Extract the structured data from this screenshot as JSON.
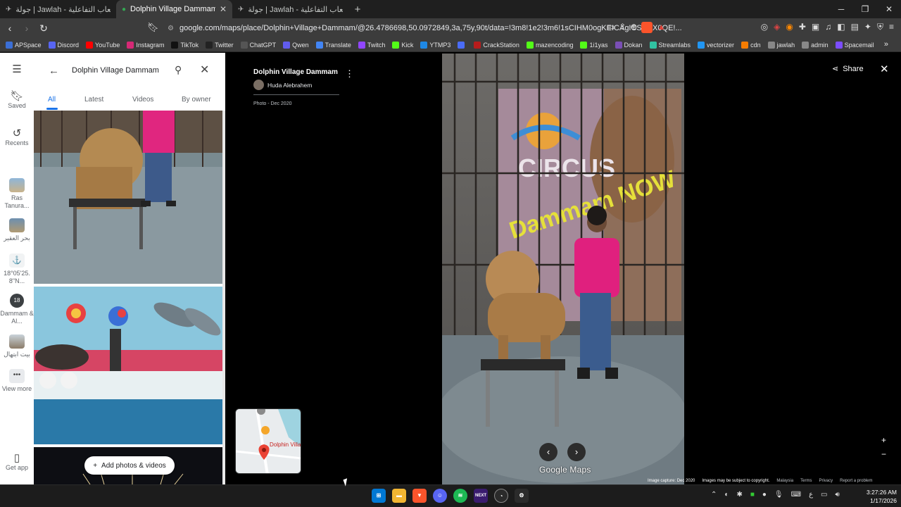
{
  "browser": {
    "tabs": [
      {
        "title": "جولة | Jawlah - منصة الألعاب التفاعلية",
        "active": false
      },
      {
        "title": "Dolphin Village Dammam - Goo",
        "active": true
      },
      {
        "title": "جولة | Jawlah - منصة الألعاب التفاعلية",
        "active": false
      }
    ],
    "url": "google.com/maps/place/Dolphin+Village+Dammam/@26.4786698,50.0972849,3a,75y,90t/data=!3m8!1e2!3m6!1sCIHM0ogKEICAgICSy9-X0QE!...",
    "bookmarks": [
      {
        "label": "APSpace",
        "color": "#3b6fd6"
      },
      {
        "label": "Discord",
        "color": "#5865f2"
      },
      {
        "label": "YouTube",
        "color": "#ff0000"
      },
      {
        "label": "Instagram",
        "color": "#d62976"
      },
      {
        "label": "TikTok",
        "color": "#111111"
      },
      {
        "label": "Twitter",
        "color": "#222222"
      },
      {
        "label": "ChatGPT",
        "color": "#555555"
      },
      {
        "label": "Qwen",
        "color": "#615ced"
      },
      {
        "label": "Translate",
        "color": "#4285f4"
      },
      {
        "label": "Twitch",
        "color": "#9146ff"
      },
      {
        "label": "Kick",
        "color": "#53fc18"
      },
      {
        "label": "YTMP3",
        "color": "#1e88e5"
      },
      {
        "label": "",
        "color": "#4a6cf7"
      },
      {
        "label": "CrackStation",
        "color": "#b71c1c"
      },
      {
        "label": "mazencoding",
        "color": "#53fc18"
      },
      {
        "label": "1i1yas",
        "color": "#53fc18"
      },
      {
        "label": "Dokan",
        "color": "#7a4fb5"
      },
      {
        "label": "Streamlabs",
        "color": "#31c3a2"
      },
      {
        "label": "vectorizer",
        "color": "#2196f3"
      },
      {
        "label": "cdn",
        "color": "#f57c00"
      },
      {
        "label": "jawlah",
        "color": "#888888"
      },
      {
        "label": "admin",
        "color": "#888888"
      },
      {
        "label": "Spacemail",
        "color": "#7c4dff"
      }
    ]
  },
  "rail": {
    "saved": "Saved",
    "recents": "Recents",
    "recent_1": "Ras Tanura...",
    "recent_2": "بحر العقير",
    "recent_3": "18°05'25. 8\"N...",
    "recent_4": "Dammam & Al...",
    "recent_5": "بيت ابتهال",
    "view_more": "View more",
    "get_app": "Get app",
    "recent_4_badge": "18"
  },
  "panel": {
    "search_value": "Dolphin Village Dammam",
    "tabs": [
      "All",
      "Latest",
      "Videos",
      "By owner"
    ],
    "add_photos": "Add photos & videos"
  },
  "viewer": {
    "place_title": "Dolphin Village Dammam",
    "author": "Huda Alebrahem",
    "photo_date": "Photo - Dec 2020",
    "share": "Share",
    "logo": "Google Maps",
    "minimap_label": "Dolphin Village Dammam",
    "footer": {
      "capture": "Image capture: Dec 2020",
      "copyright": "Images may be subject to copyright.",
      "region": "Malaysia",
      "terms": "Terms",
      "privacy": "Privacy",
      "report": "Report a problem"
    },
    "sign_top": "CIRCUS",
    "sign_bottom": "Dammam NOW"
  },
  "taskbar": {
    "time": "3:27:26 AM",
    "date": "1/17/2026",
    "lang": "ع",
    "next_label": "NEXT"
  },
  "colors": {
    "accent": "#1a73e8",
    "panel_bg": "#ffffff",
    "viewer_bg": "#000000"
  }
}
